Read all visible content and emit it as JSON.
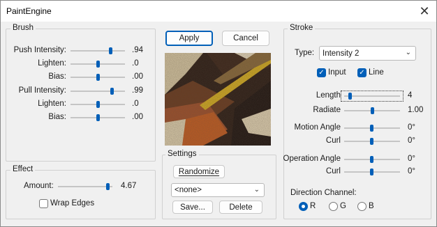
{
  "window": {
    "title": "PaintEngine"
  },
  "brush": {
    "legend": "Brush",
    "rows": [
      {
        "label": "Push Intensity:",
        "value": ".94",
        "level": 0.94
      },
      {
        "label": "Lighten:",
        "value": ".0",
        "level": 0.5
      },
      {
        "label": "Bias:",
        "value": ".00",
        "level": 0.5
      },
      {
        "label": "Pull Intensity:",
        "value": ".99",
        "level": 0.99
      },
      {
        "label": "Lighten:",
        "value": ".0",
        "level": 0.5
      },
      {
        "label": "Bias:",
        "value": ".00",
        "level": 0.5
      }
    ]
  },
  "effect": {
    "legend": "Effect",
    "amount_label": "Amount:",
    "amount_value": "4.67",
    "amount_level": 0.94,
    "wrap_edges_label": "Wrap Edges",
    "wrap_edges_checked": false
  },
  "buttons": {
    "apply": "Apply",
    "cancel": "Cancel"
  },
  "settings": {
    "legend": "Settings",
    "randomize": "Randomize",
    "preset_value": "<none>",
    "save": "Save...",
    "delete": "Delete"
  },
  "stroke": {
    "legend": "Stroke",
    "type_label": "Type:",
    "type_value": "Intensity 2",
    "input_label": "Input",
    "input_checked": true,
    "line_label": "Line",
    "line_checked": true,
    "length_label": "Length",
    "length_value": "4",
    "length_level": 0.05,
    "radiate_label": "Radiate",
    "radiate_value": "1.00",
    "radiate_level": 0.5,
    "motion_angle_label": "Motion Angle",
    "motion_angle_value": "0°",
    "motion_curl_label": "Curl",
    "motion_curl_value": "0°",
    "operation_angle_label": "Operation Angle",
    "operation_angle_value": "0°",
    "operation_curl_label": "Curl",
    "operation_curl_value": "0°",
    "direction_label": "Direction Channel:",
    "channels": [
      {
        "label": "R",
        "selected": true
      },
      {
        "label": "G",
        "selected": false
      },
      {
        "label": "B",
        "selected": false
      }
    ]
  },
  "colors": {
    "accent": "#005fb8"
  }
}
